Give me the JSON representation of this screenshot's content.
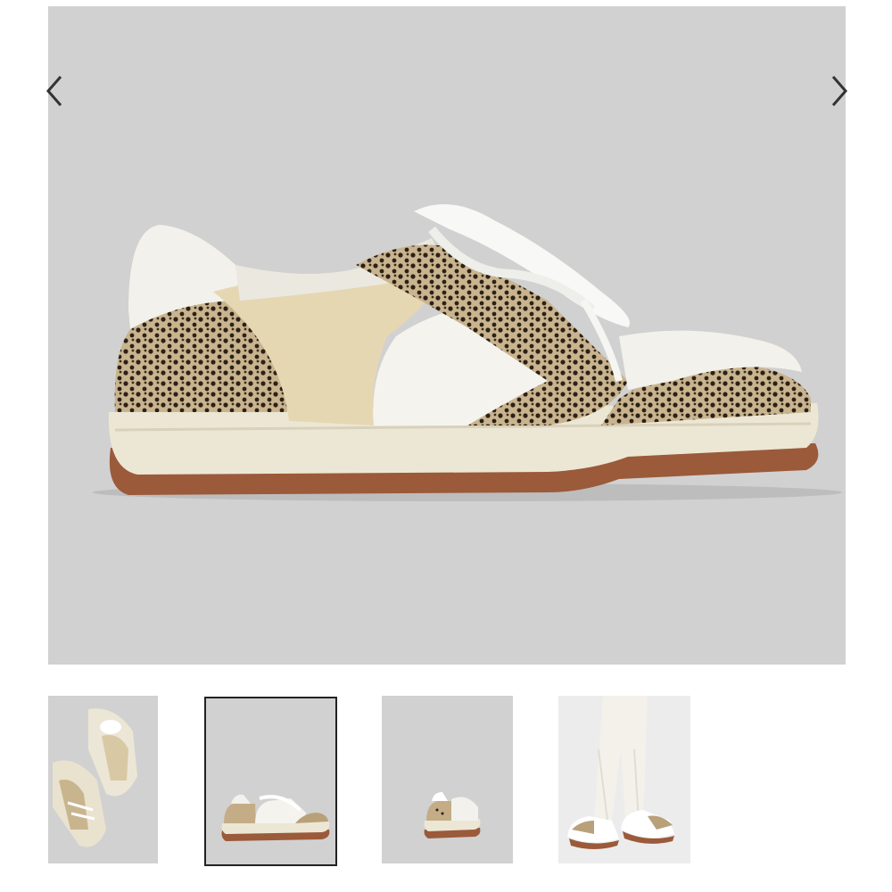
{
  "gallery": {
    "product_name": "Sneaker",
    "main_image": "sneaker-side-view",
    "selected_index": 1,
    "thumbnails": [
      {
        "name": "sneaker-pair-top-view"
      },
      {
        "name": "sneaker-side-view"
      },
      {
        "name": "sneaker-back-view"
      },
      {
        "name": "sneaker-worn-model-view"
      }
    ],
    "colors": {
      "image_bg": "#d1d1d1",
      "selected_border": "#222222",
      "arrow": "#333333"
    }
  }
}
